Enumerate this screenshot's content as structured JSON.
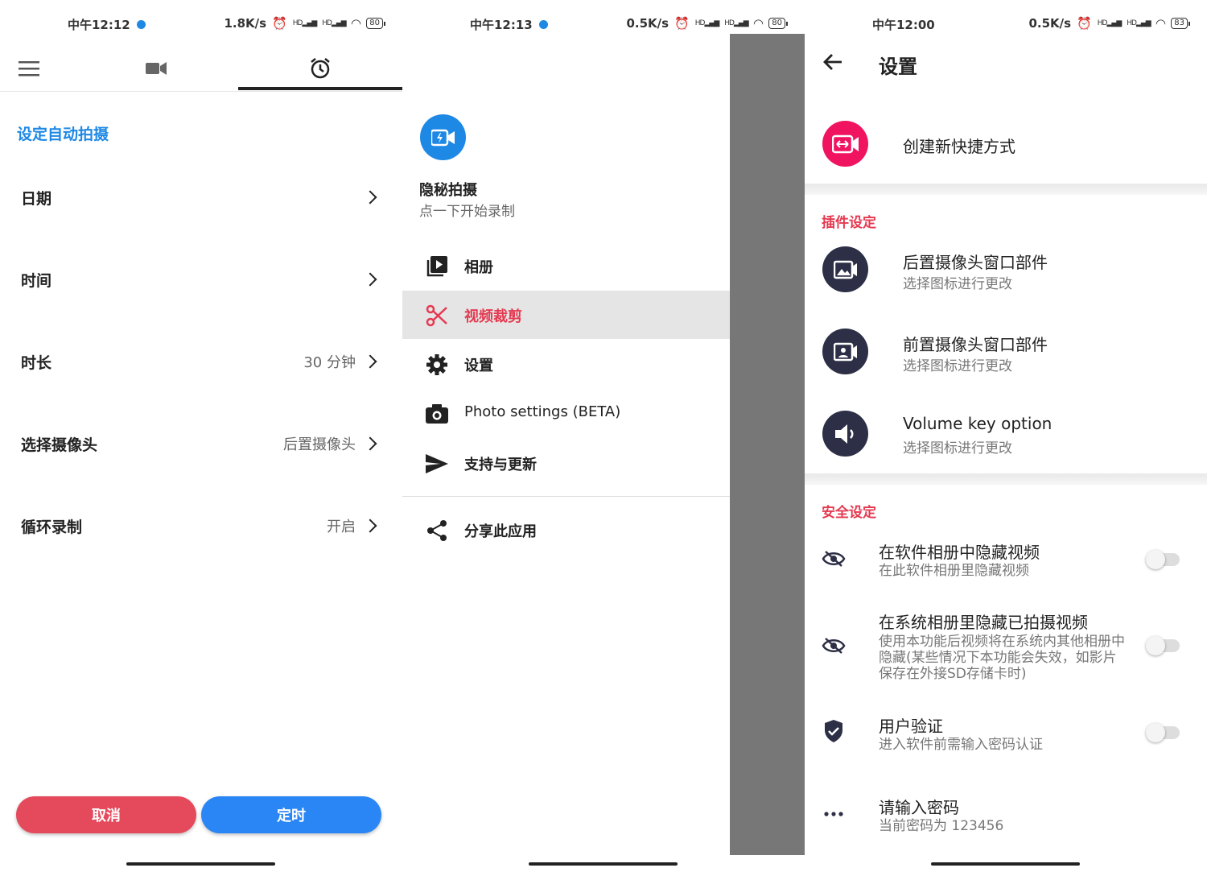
{
  "panel1": {
    "status": {
      "time": "中午12:12",
      "speed": "1.8K/s",
      "battery": "80",
      "hd1": "HD",
      "hd2": "HD"
    },
    "section_title": "设定自动拍摄",
    "rows": [
      {
        "label": "日期",
        "value": ""
      },
      {
        "label": "时间",
        "value": ""
      },
      {
        "label": "时长",
        "value": "30 分钟"
      },
      {
        "label": "选择摄像头",
        "value": "后置摄像头"
      },
      {
        "label": "循环录制",
        "value": "开启"
      }
    ],
    "cancel_label": "取消",
    "timer_label": "定时",
    "colors": {
      "accent": "#1e88e5",
      "cancel": "#e54a5c",
      "confirm": "#2a86f5"
    }
  },
  "panel2": {
    "status": {
      "time": "中午12:13",
      "speed": "0.5K/s",
      "battery": "80",
      "hd1": "HD",
      "hd2": "HD"
    },
    "app_name": "隐秘拍摄",
    "app_subtitle": "点一下开始录制",
    "menu": [
      {
        "label": "相册",
        "icon": "video-library-icon"
      },
      {
        "label": "视频裁剪",
        "icon": "scissors-icon"
      },
      {
        "label": "设置",
        "icon": "gear-icon"
      },
      {
        "label": "Photo settings (BETA)",
        "icon": "camera-icon"
      },
      {
        "label": "支持与更新",
        "icon": "send-icon"
      },
      {
        "label": "分享此应用",
        "icon": "share-icon"
      }
    ]
  },
  "panel3": {
    "status": {
      "time": "中午12:00",
      "speed": "0.5K/s",
      "battery": "83",
      "hd1": "HD",
      "hd2": "HD"
    },
    "title": "设置",
    "shortcut": "创建新快捷方式",
    "plugin_section": "插件设定",
    "plugins": [
      {
        "title": "后置摄像头窗口部件",
        "subtitle": "选择图标进行更改"
      },
      {
        "title": "前置摄像头窗口部件",
        "subtitle": "选择图标进行更改"
      },
      {
        "title": "Volume key option",
        "subtitle": "选择图标进行更改"
      }
    ],
    "security_section": "安全设定",
    "security": [
      {
        "title": "在软件相册中隐藏视频",
        "subtitle": "在此软件相册里隐藏视频"
      },
      {
        "title": "在系统相册里隐藏已拍摄视频",
        "subtitle": "使用本功能后视频将在系统内其他相册中隐藏(某些情况下本功能会失效，如影片保存在外接SD存储卡时)"
      },
      {
        "title": "用户验证",
        "subtitle": "进入软件前需输入密码认证"
      },
      {
        "title": "请输入密码",
        "subtitle": "当前密码为 123456"
      }
    ]
  }
}
